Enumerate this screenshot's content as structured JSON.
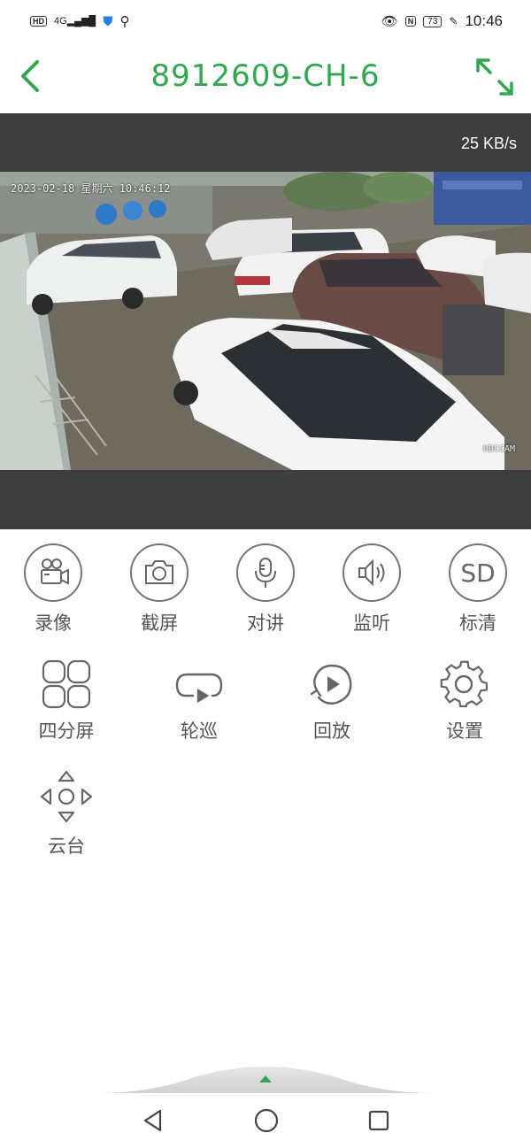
{
  "status_bar": {
    "hd": "HD",
    "network": "4G",
    "time": "10:46",
    "nfc": "N",
    "battery": "73"
  },
  "header": {
    "title": "8912609-CH-6",
    "accent_color": "#2fa84f"
  },
  "video": {
    "bitrate": "25 KB/s",
    "osd_timestamp": "2023-02-18 星期六 10:46:12",
    "osd_brand": "HDCCAM"
  },
  "controls_row1": [
    {
      "label": "录像",
      "icon": "video-camera-icon"
    },
    {
      "label": "截屏",
      "icon": "camera-icon"
    },
    {
      "label": "对讲",
      "icon": "microphone-icon"
    },
    {
      "label": "监听",
      "icon": "speaker-icon"
    },
    {
      "label": "标清",
      "icon": "sd-icon",
      "badge": "SD"
    }
  ],
  "controls_row2": [
    {
      "label": "四分屏",
      "icon": "quad-screen-icon"
    },
    {
      "label": "轮巡",
      "icon": "cycle-icon"
    },
    {
      "label": "回放",
      "icon": "playback-icon"
    },
    {
      "label": "设置",
      "icon": "gear-icon"
    }
  ],
  "controls_row3": [
    {
      "label": "云台",
      "icon": "ptz-icon"
    }
  ]
}
